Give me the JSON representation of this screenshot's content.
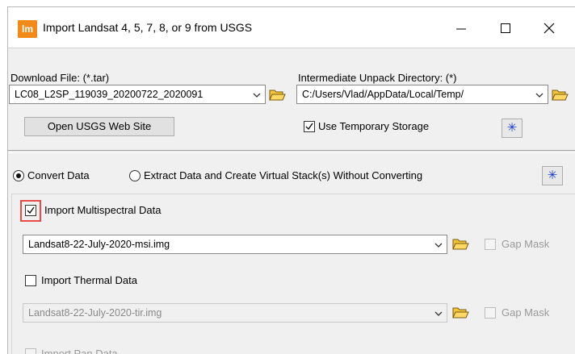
{
  "window": {
    "icon_text": "lm",
    "title": "Import Landsat 4, 5, 7, 8, or 9 from USGS",
    "controls": {
      "minimize": "—",
      "maximize": "☐",
      "close": "✕"
    }
  },
  "top_panel": {
    "download_label": "Download File: (*.tar)",
    "download_value": "LC08_L2SP_119039_20200722_2020091",
    "unpack_label": "Intermediate Unpack Directory: (*)",
    "unpack_value": "C:/Users/Vlad/AppData/Local/Temp/",
    "open_usgs_button": "Open USGS Web Site",
    "use_temp_storage": {
      "label": "Use Temporary Storage",
      "checked": true
    },
    "star_symbol": "✳"
  },
  "bottom_panel": {
    "convert_radio": {
      "label": "Convert Data",
      "selected": true
    },
    "extract_radio": {
      "label": "Extract Data and Create Virtual Stack(s) Without Converting",
      "selected": false
    },
    "star_symbol": "✳",
    "multispectral": {
      "label": "Import Multispectral Data",
      "checked": true,
      "file": "Landsat8-22-July-2020-msi.img",
      "gap_mask": "Gap Mask"
    },
    "thermal": {
      "label": "Import Thermal Data",
      "checked": false,
      "file": "Landsat8-22-July-2020-tir.img",
      "gap_mask": "Gap Mask"
    },
    "pan": {
      "label": "Import Pan Data",
      "checked": false
    }
  }
}
